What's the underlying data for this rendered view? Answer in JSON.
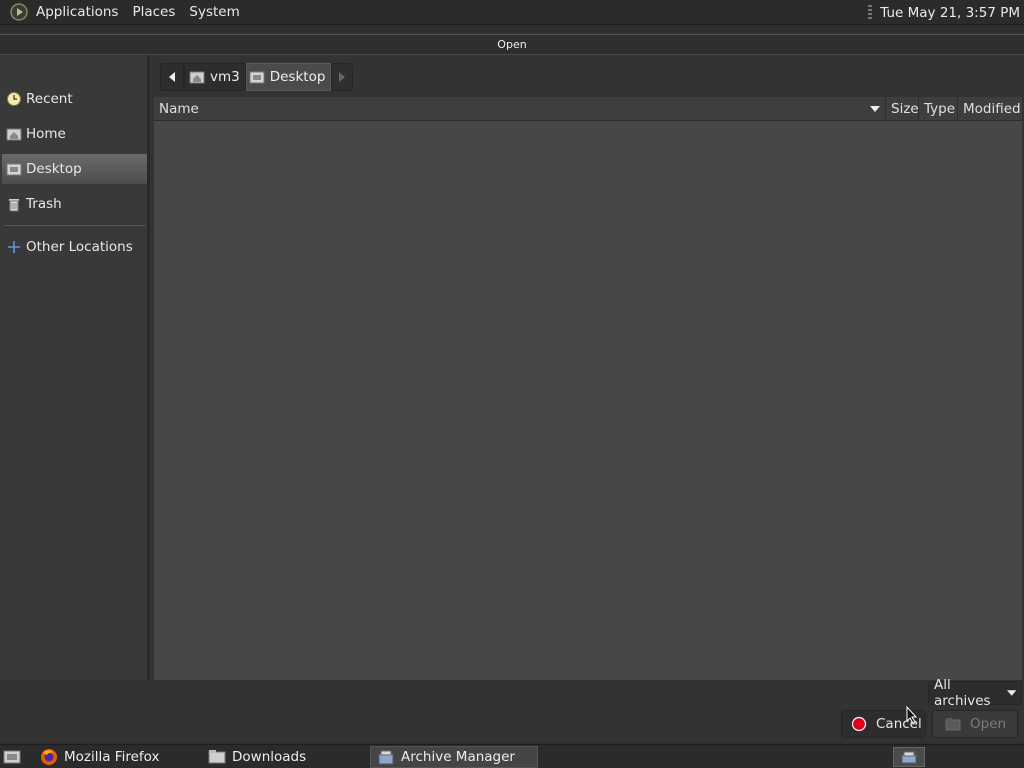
{
  "top_panel": {
    "menus": [
      "Applications",
      "Places",
      "System"
    ],
    "clock": "Tue May 21,  3:57 PM"
  },
  "dialog": {
    "title": "Open",
    "sidebar": {
      "items": [
        {
          "label": "Recent",
          "icon": "clock-icon"
        },
        {
          "label": "Home",
          "icon": "home-folder-icon"
        },
        {
          "label": "Desktop",
          "icon": "desktop-folder-icon",
          "selected": true
        },
        {
          "label": "Trash",
          "icon": "trash-icon"
        },
        {
          "label": "Other Locations",
          "icon": "plus-icon"
        }
      ]
    },
    "pathbar": {
      "segments": [
        "vm3",
        "Desktop"
      ],
      "current": "Desktop"
    },
    "columns": [
      "Name",
      "Size",
      "Type",
      "Modified"
    ],
    "files": [],
    "filter": {
      "selected": "All archives"
    },
    "buttons": {
      "cancel": "Cancel",
      "open": "Open"
    }
  },
  "taskbar": {
    "tasks": [
      {
        "label": "Mozilla Firefox",
        "icon": "firefox-icon"
      },
      {
        "label": "Downloads",
        "icon": "folder-icon"
      },
      {
        "label": "Archive Manager",
        "icon": "archive-manager-icon",
        "active": true
      }
    ]
  },
  "colors": {
    "panel_bg": "#2b2b2b",
    "dialog_bg": "#333333",
    "list_bg": "#474747",
    "cancel_red": "#e0001b"
  }
}
